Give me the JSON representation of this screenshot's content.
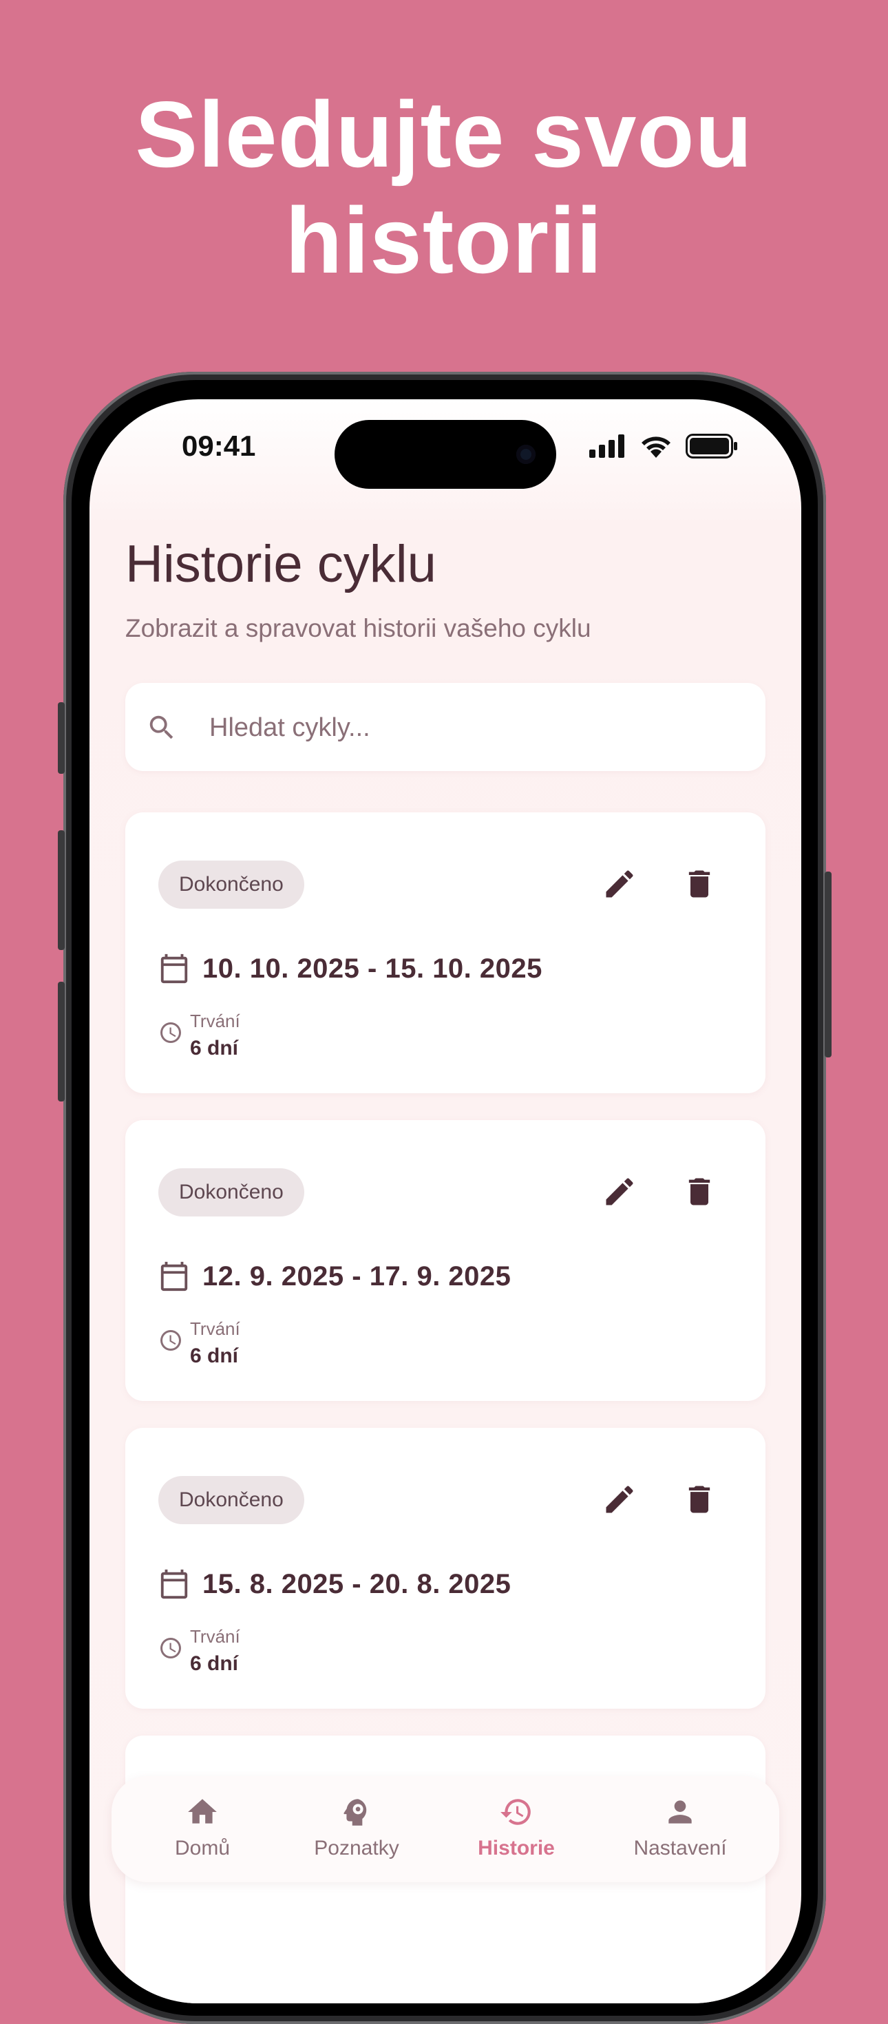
{
  "headline": {
    "line1": "Sledujte svou",
    "line2": "historii"
  },
  "status_bar": {
    "time": "09:41"
  },
  "page": {
    "title": "Historie cyklu",
    "subtitle": "Zobrazit a spravovat historii vašeho cyklu"
  },
  "search": {
    "placeholder": "Hledat cykly...",
    "value": "",
    "icon": "search-icon"
  },
  "cycles": [
    {
      "status": "Dokončeno",
      "dates": "10. 10. 2025 - 15. 10. 2025",
      "duration_label": "Trvání",
      "duration_value": "6 dní"
    },
    {
      "status": "Dokončeno",
      "dates": "12. 9. 2025 - 17. 9. 2025",
      "duration_label": "Trvání",
      "duration_value": "6 dní"
    },
    {
      "status": "Dokončeno",
      "dates": "15. 8. 2025 - 20. 8. 2025",
      "duration_label": "Trvání",
      "duration_value": "6 dní"
    }
  ],
  "nav": {
    "items": [
      {
        "label": "Domů",
        "icon": "home-icon"
      },
      {
        "label": "Poznatky",
        "icon": "insights-head-icon"
      },
      {
        "label": "Historie",
        "icon": "history-icon",
        "active": true
      },
      {
        "label": "Nastavení",
        "icon": "person-icon"
      }
    ]
  },
  "colors": {
    "background": "#d7738e",
    "accent": "#d7738e",
    "text_primary": "#4a2c36",
    "text_secondary": "#8a6f77",
    "badge_bg": "#ece4e6"
  }
}
